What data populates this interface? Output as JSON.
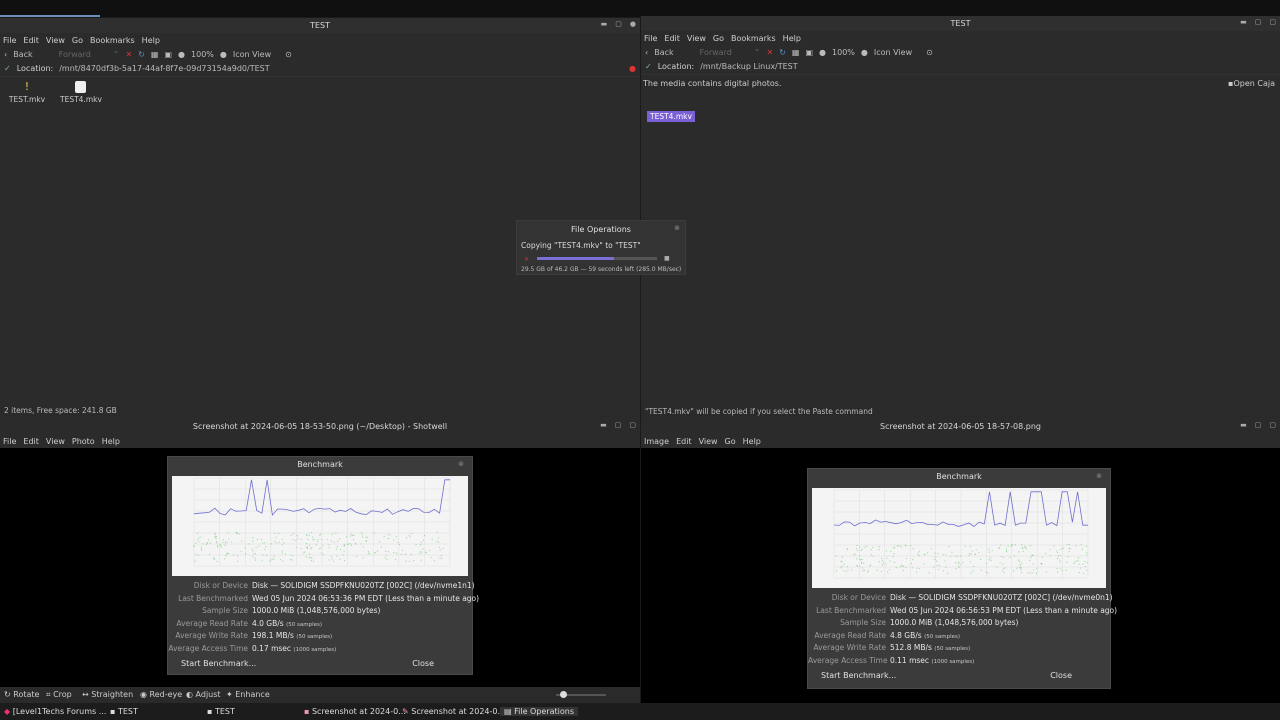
{
  "top_left_window": {
    "title": "TEST",
    "menu": [
      "File",
      "Edit",
      "View",
      "Go",
      "Bookmarks",
      "Help"
    ],
    "toolbar": {
      "back": "Back",
      "forward": "Forward",
      "zoom": "100%",
      "view": "Icon View"
    },
    "location_label": "Location:",
    "location_value": "/mnt/8470df3b-5a17-44af-8f7e-09d73154a9d0/TEST",
    "files": [
      {
        "name": "TEST.mkv"
      },
      {
        "name": "TEST4.mkv"
      }
    ],
    "status": "2 items, Free space: 241.8 GB"
  },
  "top_right_window": {
    "title": "TEST",
    "menu": [
      "File",
      "Edit",
      "View",
      "Go",
      "Bookmarks",
      "Help"
    ],
    "toolbar": {
      "back": "Back",
      "forward": "Forward",
      "zoom": "100%",
      "view": "Icon View"
    },
    "location_label": "Location:",
    "location_value": "/mnt/Backup Linux/TEST",
    "info_message": "The media contains digital photos.",
    "open_button": "Open Caja",
    "selected_file": "TEST4.mkv",
    "status": "\"TEST4.mkv\" will be copied if you select the Paste command"
  },
  "file_operations": {
    "title": "File Operations",
    "copying": "Copying \"TEST4.mkv\" to \"TEST\"",
    "progress": 0.64,
    "detail": "29.5 GB of 46.2 GB — 59 seconds left (285.0 MB/sec)"
  },
  "bottom_left_window": {
    "title": "Screenshot at 2024-06-05 18-53-50.png (~/Desktop) - Shotwell",
    "menu": [
      "File",
      "Edit",
      "View",
      "Photo",
      "Help"
    ],
    "bottom_tools": [
      "Rotate",
      "Crop",
      "Straighten",
      "Red-eye",
      "Adjust",
      "Enhance"
    ]
  },
  "bottom_right_window": {
    "title": "Screenshot at 2024-06-05 18-57-08.png",
    "menu": [
      "Image",
      "Edit",
      "View",
      "Go",
      "Help"
    ]
  },
  "bench_left": {
    "title": "Benchmark",
    "rows": [
      {
        "k": "Disk or Device",
        "v": "Disk — SOLIDIGM SSDPFKNU020TZ [002C] (/dev/nvme1n1)",
        "s": ""
      },
      {
        "k": "Last Benchmarked",
        "v": "Wed 05 Jun 2024 06:53:36 PM EDT (Less than a minute ago)",
        "s": ""
      },
      {
        "k": "Sample Size",
        "v": "1000.0 MiB (1,048,576,000 bytes)",
        "s": ""
      },
      {
        "k": "Average Read Rate",
        "v": "4.0 GB/s",
        "s": "(50 samples)"
      },
      {
        "k": "Average Write Rate",
        "v": "198.1 MB/s",
        "s": "(50 samples)"
      },
      {
        "k": "Average Access Time",
        "v": "0.17 msec",
        "s": "(1000 samples)"
      }
    ],
    "start_button": "Start Benchmark...",
    "close_button": "Close"
  },
  "bench_right": {
    "title": "Benchmark",
    "rows": [
      {
        "k": "Disk or Device",
        "v": "Disk — SOLIDIGM SSDPFKNU020TZ [002C] (/dev/nvme0n1)",
        "s": ""
      },
      {
        "k": "Last Benchmarked",
        "v": "Wed 05 Jun 2024 06:56:53 PM EDT (Less than a minute ago)",
        "s": ""
      },
      {
        "k": "Sample Size",
        "v": "1000.0 MiB (1,048,576,000 bytes)",
        "s": ""
      },
      {
        "k": "Average Read Rate",
        "v": "4.8 GB/s",
        "s": "(50 samples)"
      },
      {
        "k": "Average Write Rate",
        "v": "512.8 MB/s",
        "s": "(50 samples)"
      },
      {
        "k": "Average Access Time",
        "v": "0.11 msec",
        "s": "(1000 samples)"
      }
    ],
    "start_button": "Start Benchmark...",
    "close_button": "Close"
  },
  "taskbar": [
    "[Level1Techs Forums ...",
    "TEST",
    "TEST",
    "Screenshot at 2024-0...",
    "Screenshot at 2024-0...",
    "File Operations"
  ],
  "colors": {
    "read_line": "#6f6fcf",
    "write_scatter": "#6ac36a",
    "selection": "#7b5fd6",
    "progress": "#7a6fd8"
  }
}
